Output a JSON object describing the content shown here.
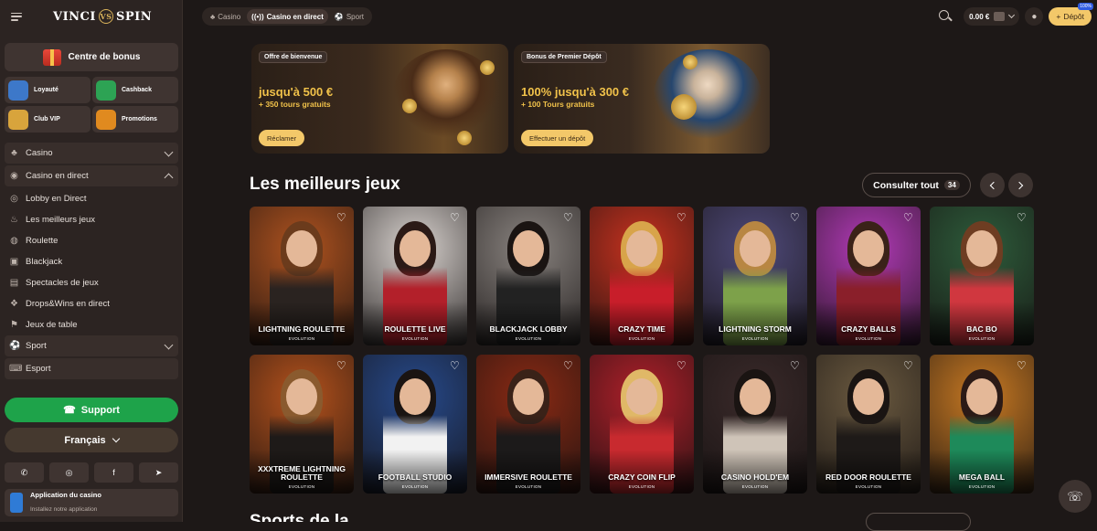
{
  "brand": {
    "logo_text_left": "VINCI",
    "logo_text_right": "SPIN"
  },
  "sidebar": {
    "bonus_center": "Centre de bonus",
    "quick": [
      {
        "label": "Loyauté",
        "icon": "shield-icon",
        "color": "#3d78c9"
      },
      {
        "label": "Cashback",
        "icon": "cashback-icon",
        "color": "#2da354"
      },
      {
        "label": "Club VIP",
        "icon": "crown-icon",
        "color": "#d8a43c"
      },
      {
        "label": "Promotions",
        "icon": "percent-icon",
        "color": "#e08a1f"
      }
    ],
    "menu": [
      {
        "label": "Casino",
        "icon": "casino-icon",
        "type": "group",
        "expanded": false
      },
      {
        "label": "Casino en direct",
        "icon": "live-icon",
        "type": "group",
        "expanded": true
      },
      {
        "label": "Lobby en Direct",
        "icon": "lobby-icon",
        "type": "item"
      },
      {
        "label": "Les meilleurs jeux",
        "icon": "fire-icon",
        "type": "item"
      },
      {
        "label": "Roulette",
        "icon": "roulette-icon",
        "type": "item"
      },
      {
        "label": "Blackjack",
        "icon": "cards-icon",
        "type": "item"
      },
      {
        "label": "Spectacles de jeux",
        "icon": "show-icon",
        "type": "item"
      },
      {
        "label": "Drops&Wins en direct",
        "icon": "drops-icon",
        "type": "item"
      },
      {
        "label": "Jeux de table",
        "icon": "table-icon",
        "type": "item"
      },
      {
        "label": "Sport",
        "icon": "sport-icon",
        "type": "group",
        "expanded": false
      },
      {
        "label": "Esport",
        "icon": "gamepad-icon",
        "type": "group"
      }
    ],
    "support": "Support",
    "language": "Français",
    "socials": [
      "whatsapp-icon",
      "instagram-icon",
      "facebook-icon",
      "telegram-icon"
    ],
    "app": {
      "title": "Application du casino",
      "subtitle": "Installez notre application"
    }
  },
  "header": {
    "tabs": [
      {
        "label": "Casino",
        "active": false
      },
      {
        "label": "Casino en direct",
        "active": true
      },
      {
        "label": "Sport",
        "active": false
      }
    ],
    "balance": "0.00 €",
    "deposit": "Dépôt",
    "deposit_badge": "100%"
  },
  "banners": [
    {
      "tag": "Offre de bienvenue",
      "amount": "jusqu'à 500 €",
      "sub": "+ 350 tours gratuits",
      "button": "Réclamer"
    },
    {
      "tag": "Bonus de Premier Dépôt",
      "amount": "100% jusqu'à 300 €",
      "sub": "+ 100 Tours gratuits",
      "button": "Effectuer un dépôt"
    }
  ],
  "best_games": {
    "title": "Les meilleurs jeux",
    "see_all": "Consulter tout",
    "count": "34",
    "games": [
      {
        "name": "LIGHTNING ROULETTE",
        "provider": "EVOLUTION",
        "bg": "#b0531f",
        "hair": "#6b3b1c",
        "outfit": "#2a2320"
      },
      {
        "name": "ROULETTE LIVE",
        "provider": "EVOLUTION",
        "bg": "#d9d3cf",
        "hair": "#2b1a16",
        "outfit": "#b3202a"
      },
      {
        "name": "BLACKJACK LOBBY",
        "provider": "EVOLUTION",
        "bg": "#8a8480",
        "hair": "#1a1412",
        "outfit": "#222"
      },
      {
        "name": "CRAZY TIME",
        "provider": "EVOLUTION",
        "bg": "#c8321f",
        "hair": "#d8a44a",
        "outfit": "#c81e2a"
      },
      {
        "name": "LIGHTNING STORM",
        "provider": "EVOLUTION",
        "bg": "#4f4a7a",
        "hair": "#b88642",
        "outfit": "#7da14a"
      },
      {
        "name": "CRAZY BALLS",
        "provider": "EVOLUTION",
        "bg": "#b33bb8",
        "hair": "#3a2218",
        "outfit": "#8a1f2a"
      },
      {
        "name": "BAC BO",
        "provider": "EVOLUTION",
        "bg": "#2e5c3b",
        "hair": "#6e3d22",
        "outfit": "#d0373f"
      },
      {
        "name": "XXXTREME LIGHTNING ROULETTE",
        "provider": "EVOLUTION",
        "bg": "#b5521c",
        "hair": "#8a5a2e",
        "outfit": "#1e1a18"
      },
      {
        "name": "FOOTBALL STUDIO",
        "provider": "EVOLUTION",
        "bg": "#274a8c",
        "hair": "#1a1412",
        "outfit": "#f2f2f2"
      },
      {
        "name": "IMMERSIVE ROULETTE",
        "provider": "EVOLUTION",
        "bg": "#8a2a14",
        "hair": "#3a2218",
        "outfit": "#1c1a1a"
      },
      {
        "name": "CRAZY COIN FLIP",
        "provider": "EVOLUTION",
        "bg": "#b0202a",
        "hair": "#e0b867",
        "outfit": "#c82a2f"
      },
      {
        "name": "CASINO HOLD'EM",
        "provider": "EVOLUTION",
        "bg": "#3a2a2a",
        "hair": "#1a1412",
        "outfit": "#cfc4b8"
      },
      {
        "name": "RED DOOR ROULETTE",
        "provider": "EVOLUTION",
        "bg": "#6b5a40",
        "hair": "#1a1412",
        "outfit": "#1e1a18"
      },
      {
        "name": "MEGA BALL",
        "provider": "EVOLUTION",
        "bg": "#c97a23",
        "hair": "#2b1a16",
        "outfit": "#1e8a5a"
      }
    ]
  },
  "next_section_title": "Sports de la ...",
  "colors": {
    "accent": "#f3c869",
    "support": "#1ea34a",
    "sidebar": "#2c2422",
    "page": "#1d1817"
  }
}
